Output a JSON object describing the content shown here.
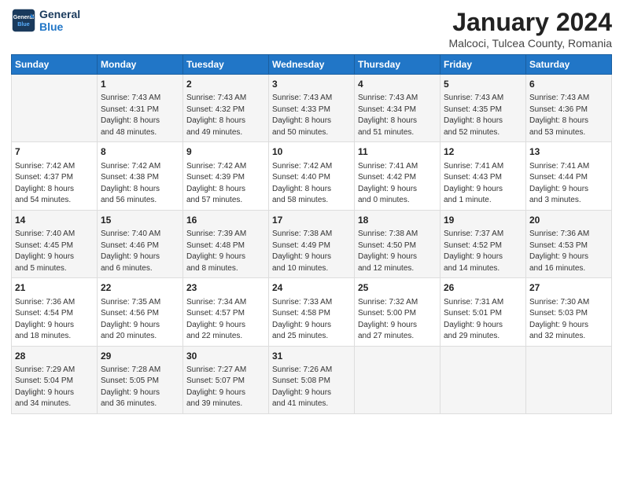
{
  "logo": {
    "line1": "General",
    "line2": "Blue"
  },
  "title": "January 2024",
  "location": "Malcoci, Tulcea County, Romania",
  "weekdays": [
    "Sunday",
    "Monday",
    "Tuesday",
    "Wednesday",
    "Thursday",
    "Friday",
    "Saturday"
  ],
  "weeks": [
    [
      {
        "day": "",
        "info": ""
      },
      {
        "day": "1",
        "info": "Sunrise: 7:43 AM\nSunset: 4:31 PM\nDaylight: 8 hours\nand 48 minutes."
      },
      {
        "day": "2",
        "info": "Sunrise: 7:43 AM\nSunset: 4:32 PM\nDaylight: 8 hours\nand 49 minutes."
      },
      {
        "day": "3",
        "info": "Sunrise: 7:43 AM\nSunset: 4:33 PM\nDaylight: 8 hours\nand 50 minutes."
      },
      {
        "day": "4",
        "info": "Sunrise: 7:43 AM\nSunset: 4:34 PM\nDaylight: 8 hours\nand 51 minutes."
      },
      {
        "day": "5",
        "info": "Sunrise: 7:43 AM\nSunset: 4:35 PM\nDaylight: 8 hours\nand 52 minutes."
      },
      {
        "day": "6",
        "info": "Sunrise: 7:43 AM\nSunset: 4:36 PM\nDaylight: 8 hours\nand 53 minutes."
      }
    ],
    [
      {
        "day": "7",
        "info": "Sunrise: 7:42 AM\nSunset: 4:37 PM\nDaylight: 8 hours\nand 54 minutes."
      },
      {
        "day": "8",
        "info": "Sunrise: 7:42 AM\nSunset: 4:38 PM\nDaylight: 8 hours\nand 56 minutes."
      },
      {
        "day": "9",
        "info": "Sunrise: 7:42 AM\nSunset: 4:39 PM\nDaylight: 8 hours\nand 57 minutes."
      },
      {
        "day": "10",
        "info": "Sunrise: 7:42 AM\nSunset: 4:40 PM\nDaylight: 8 hours\nand 58 minutes."
      },
      {
        "day": "11",
        "info": "Sunrise: 7:41 AM\nSunset: 4:42 PM\nDaylight: 9 hours\nand 0 minutes."
      },
      {
        "day": "12",
        "info": "Sunrise: 7:41 AM\nSunset: 4:43 PM\nDaylight: 9 hours\nand 1 minute."
      },
      {
        "day": "13",
        "info": "Sunrise: 7:41 AM\nSunset: 4:44 PM\nDaylight: 9 hours\nand 3 minutes."
      }
    ],
    [
      {
        "day": "14",
        "info": "Sunrise: 7:40 AM\nSunset: 4:45 PM\nDaylight: 9 hours\nand 5 minutes."
      },
      {
        "day": "15",
        "info": "Sunrise: 7:40 AM\nSunset: 4:46 PM\nDaylight: 9 hours\nand 6 minutes."
      },
      {
        "day": "16",
        "info": "Sunrise: 7:39 AM\nSunset: 4:48 PM\nDaylight: 9 hours\nand 8 minutes."
      },
      {
        "day": "17",
        "info": "Sunrise: 7:38 AM\nSunset: 4:49 PM\nDaylight: 9 hours\nand 10 minutes."
      },
      {
        "day": "18",
        "info": "Sunrise: 7:38 AM\nSunset: 4:50 PM\nDaylight: 9 hours\nand 12 minutes."
      },
      {
        "day": "19",
        "info": "Sunrise: 7:37 AM\nSunset: 4:52 PM\nDaylight: 9 hours\nand 14 minutes."
      },
      {
        "day": "20",
        "info": "Sunrise: 7:36 AM\nSunset: 4:53 PM\nDaylight: 9 hours\nand 16 minutes."
      }
    ],
    [
      {
        "day": "21",
        "info": "Sunrise: 7:36 AM\nSunset: 4:54 PM\nDaylight: 9 hours\nand 18 minutes."
      },
      {
        "day": "22",
        "info": "Sunrise: 7:35 AM\nSunset: 4:56 PM\nDaylight: 9 hours\nand 20 minutes."
      },
      {
        "day": "23",
        "info": "Sunrise: 7:34 AM\nSunset: 4:57 PM\nDaylight: 9 hours\nand 22 minutes."
      },
      {
        "day": "24",
        "info": "Sunrise: 7:33 AM\nSunset: 4:58 PM\nDaylight: 9 hours\nand 25 minutes."
      },
      {
        "day": "25",
        "info": "Sunrise: 7:32 AM\nSunset: 5:00 PM\nDaylight: 9 hours\nand 27 minutes."
      },
      {
        "day": "26",
        "info": "Sunrise: 7:31 AM\nSunset: 5:01 PM\nDaylight: 9 hours\nand 29 minutes."
      },
      {
        "day": "27",
        "info": "Sunrise: 7:30 AM\nSunset: 5:03 PM\nDaylight: 9 hours\nand 32 minutes."
      }
    ],
    [
      {
        "day": "28",
        "info": "Sunrise: 7:29 AM\nSunset: 5:04 PM\nDaylight: 9 hours\nand 34 minutes."
      },
      {
        "day": "29",
        "info": "Sunrise: 7:28 AM\nSunset: 5:05 PM\nDaylight: 9 hours\nand 36 minutes."
      },
      {
        "day": "30",
        "info": "Sunrise: 7:27 AM\nSunset: 5:07 PM\nDaylight: 9 hours\nand 39 minutes."
      },
      {
        "day": "31",
        "info": "Sunrise: 7:26 AM\nSunset: 5:08 PM\nDaylight: 9 hours\nand 41 minutes."
      },
      {
        "day": "",
        "info": ""
      },
      {
        "day": "",
        "info": ""
      },
      {
        "day": "",
        "info": ""
      }
    ]
  ]
}
